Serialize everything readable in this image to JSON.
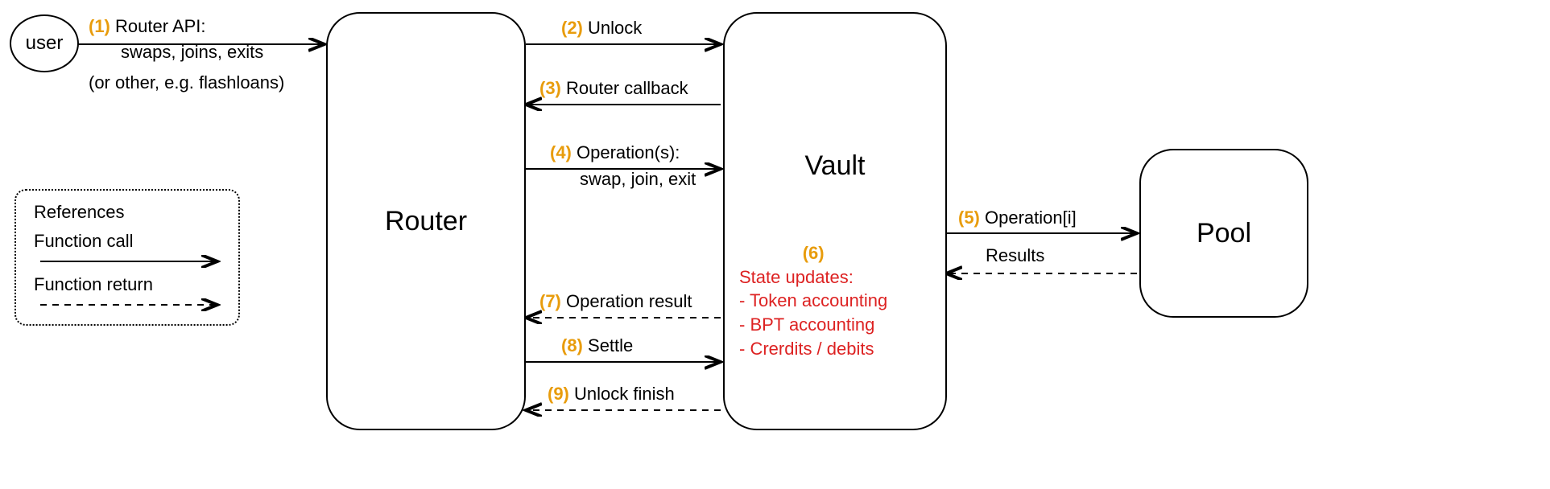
{
  "nodes": {
    "user": "user",
    "router": "Router",
    "vault": "Vault",
    "pool": "Pool"
  },
  "steps": {
    "s1_num": "(1)",
    "s1_line1": "Router API:",
    "s1_line2": "swaps, joins, exits",
    "s1_line3": "(or other, e.g. flashloans)",
    "s2_num": "(2)",
    "s2_label": "Unlock",
    "s3_num": "(3)",
    "s3_label": "Router callback",
    "s4_num": "(4)",
    "s4_line1": "Operation(s):",
    "s4_line2": "swap, join, exit",
    "s5_num": "(5)",
    "s5_label": "Operation[i]",
    "s5_return": "Results",
    "s6_num": "(6)",
    "s6_line1": "State updates:",
    "s6_line2": "- Token accounting",
    "s6_line3": "- BPT accounting",
    "s6_line4": "- Crerdits / debits",
    "s7_num": "(7)",
    "s7_label": "Operation result",
    "s8_num": "(8)",
    "s8_label": "Settle",
    "s9_num": "(9)",
    "s9_label": "Unlock finish"
  },
  "references": {
    "title": "References",
    "call": "Function call",
    "ret": "Function return"
  }
}
